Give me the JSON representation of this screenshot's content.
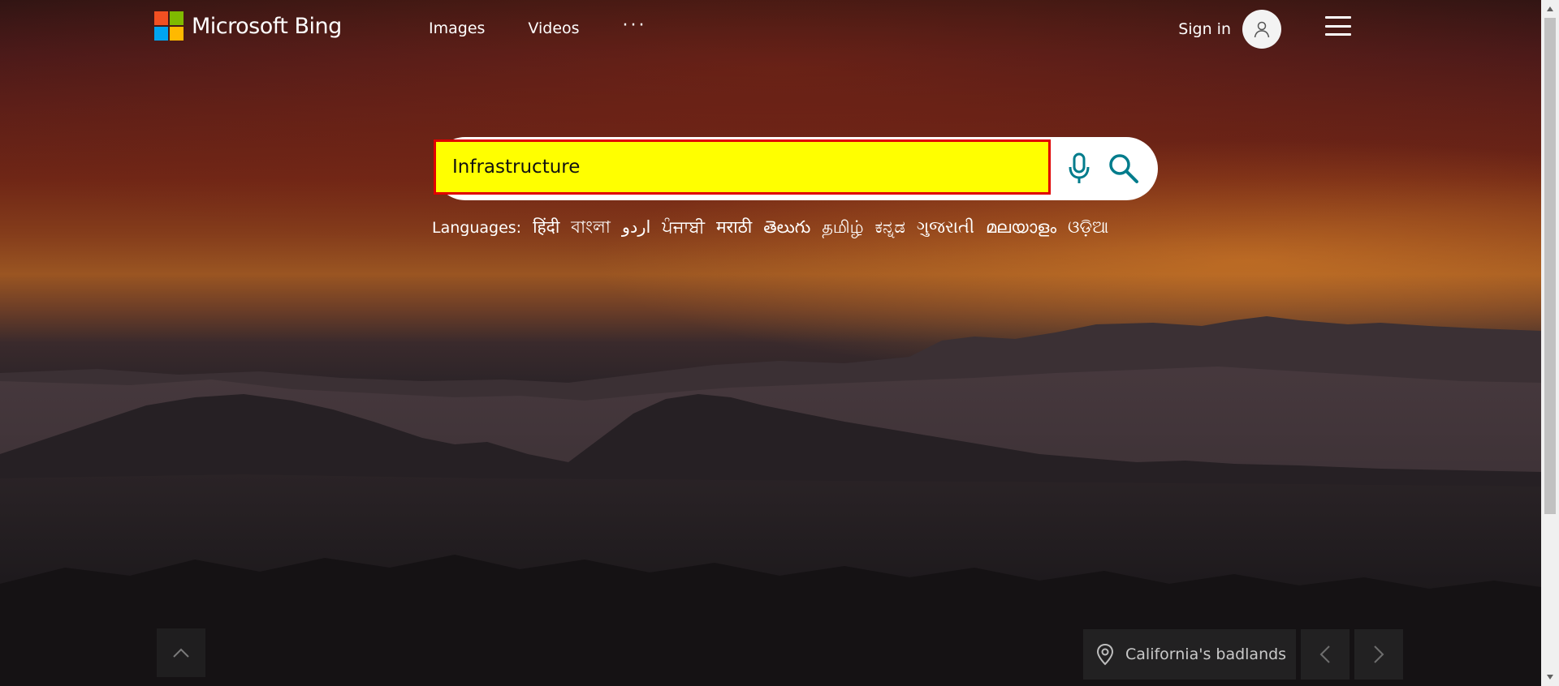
{
  "header": {
    "logo_text": "Microsoft Bing",
    "logo_colors": [
      "#f25022",
      "#7fba00",
      "#00a4ef",
      "#ffb900"
    ],
    "nav": [
      {
        "label": "Images"
      },
      {
        "label": "Videos"
      },
      {
        "label": "···"
      }
    ],
    "sign_in_label": "Sign in"
  },
  "search": {
    "value": "Infrastructure",
    "highlight_color": "#ffff00",
    "border_color": "#e00000",
    "icon_color": "#007c8c"
  },
  "languages": {
    "label": "Languages:",
    "items": [
      "हिंदी",
      "বাংলা",
      "اردو",
      "ਪੰਜਾਬੀ",
      "मराठी",
      "తెలుగు",
      "தமிழ்",
      "ಕನ್ನಡ",
      "ગુજરાતી",
      "മലയാളം",
      "ଓଡ଼ିଆ"
    ]
  },
  "footer": {
    "location_label": "California's badlands"
  }
}
